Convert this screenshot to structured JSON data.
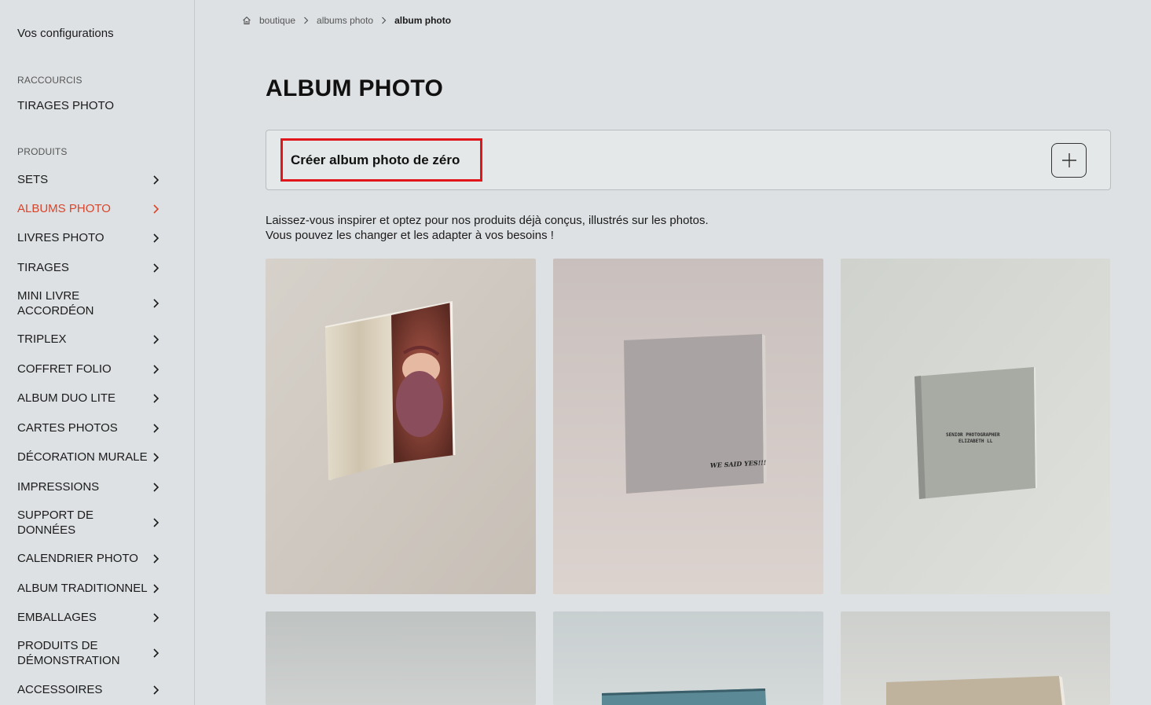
{
  "sidebar": {
    "configurations": "Vos configurations",
    "shortcuts_title": "RACCOURCIS",
    "shortcuts": [
      "TIRAGES PHOTO"
    ],
    "products_title": "PRODUITS",
    "items": [
      {
        "label": "SETS"
      },
      {
        "label": "ALBUMS PHOTO",
        "active": true
      },
      {
        "label": "LIVRES PHOTO"
      },
      {
        "label": "TIRAGES"
      },
      {
        "label": "MINI LIVRE ACCORDÉON"
      },
      {
        "label": "TRIPLEX"
      },
      {
        "label": "COFFRET FOLIO"
      },
      {
        "label": "ALBUM DUO LITE"
      },
      {
        "label": "CARTES PHOTOS"
      },
      {
        "label": "DÉCORATION MURALE"
      },
      {
        "label": "IMPRESSIONS"
      },
      {
        "label": "SUPPORT DE DONNÉES"
      },
      {
        "label": "CALENDRIER PHOTO"
      },
      {
        "label": "ALBUM TRADITIONNEL"
      },
      {
        "label": "EMBALLAGES"
      },
      {
        "label": "PRODUITS DE DÉMONSTRATION"
      },
      {
        "label": "ACCESSOIRES"
      }
    ]
  },
  "breadcrumb": {
    "items": [
      "boutique",
      "albums photo",
      "album photo"
    ]
  },
  "page": {
    "title": "ALBUM PHOTO",
    "create_label": "Créer album photo de zéro",
    "intro_line1": "Laissez-vous inspirer et optez pour nos produits déjà conçus, illustrés sur les photos.",
    "intro_line2": "Vous pouvez les changer et les adapter à vos besoins !"
  },
  "products": {
    "album2_text": "WE SAID YES!!!",
    "album3_text_line1": "SENIOR PHOTOGRAPHER",
    "album3_text_line2": "ELIZABETH LL"
  },
  "colors": {
    "accent": "#d9452b",
    "highlight_border": "#e0161b",
    "background": "#dde1e3"
  }
}
